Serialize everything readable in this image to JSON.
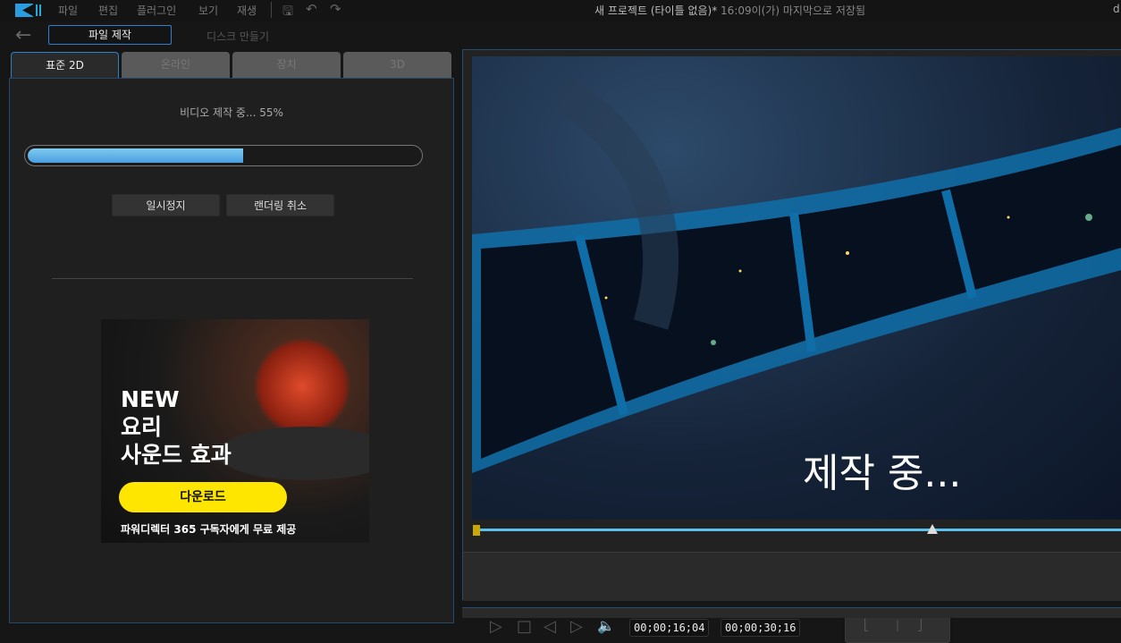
{
  "menu": {
    "items": [
      "파일",
      "편집",
      "플러그인",
      "보기",
      "재생"
    ]
  },
  "title": {
    "project": "새 프로젝트 (타이틀 없음)*",
    "saved": "16:09이(가) 마지막으로 저장됨",
    "right": "d"
  },
  "nav": {
    "produce_label": "파일 제작",
    "disc_label": "디스크 만들기"
  },
  "tabs": [
    {
      "label": "표준 2D"
    },
    {
      "label": "온라인"
    },
    {
      "label": "장치"
    },
    {
      "label": "3D"
    }
  ],
  "progress": {
    "status": "비디오 제작 중... 55%",
    "percent": 55,
    "pause_label": "일시정지",
    "cancel_label": "랜더링 취소"
  },
  "ad": {
    "line1": "NEW",
    "line2": "요리",
    "line3": "사운드 효과",
    "button": "다운로드",
    "footer": "파워디렉터 365 구독자에게 무료 제공"
  },
  "preview": {
    "overlay": "제작 중...",
    "current_time": "00;00;16;04",
    "total_time": "00;00;30;16",
    "playhead_fraction": 0.7
  },
  "colors": {
    "accent": "#2d7fc9",
    "progress": "#5aaee8"
  }
}
